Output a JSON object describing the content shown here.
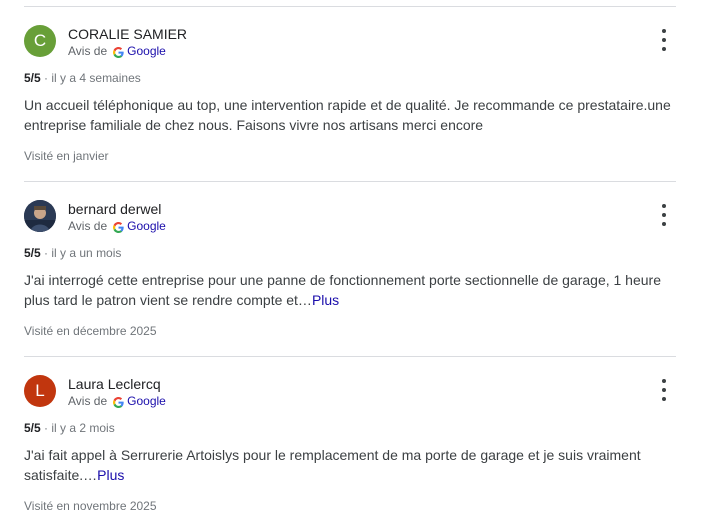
{
  "reviews": [
    {
      "author": "CORALIE SAMIER",
      "avatar_letter": "C",
      "avatar_color": "#689f38",
      "source_prefix": "Avis de",
      "source_name": "Google",
      "rating": "5/5",
      "time": "il y a 4 semaines",
      "text": "Un accueil téléphonique au top, une intervention rapide et de qualité. Je recommande ce prestataire.une entreprise familiale de chez nous. Faisons vivre nos artisans merci encore",
      "more": "",
      "visited": "Visité en janvier"
    },
    {
      "author": "bernard derwel",
      "avatar_letter": "",
      "avatar_color": "#2b3a55",
      "source_prefix": "Avis de",
      "source_name": "Google",
      "rating": "5/5",
      "time": "il y a un mois",
      "text": "J'ai interrogé cette entreprise pour une panne de fonctionnement porte sectionnelle de garage, 1 heure plus tard le patron vient se rendre compte et…",
      "more": "Plus",
      "visited": "Visité en décembre 2025"
    },
    {
      "author": "Laura Leclercq",
      "avatar_letter": "L",
      "avatar_color": "#c1360e",
      "source_prefix": "Avis de",
      "source_name": "Google",
      "rating": "5/5",
      "time": "il y a 2 mois",
      "text": "J'ai fait appel à Serrurerie Artoislys pour le remplacement de ma porte de garage et je suis vraiment satisfaite.…",
      "more": "Plus",
      "visited": "Visité en novembre 2025"
    }
  ],
  "meta_separator": "·",
  "colors": {
    "link": "#1a0dab",
    "divider": "#dadce0"
  },
  "icons": {
    "source": "google-g-icon",
    "menu": "more-vert-icon"
  }
}
